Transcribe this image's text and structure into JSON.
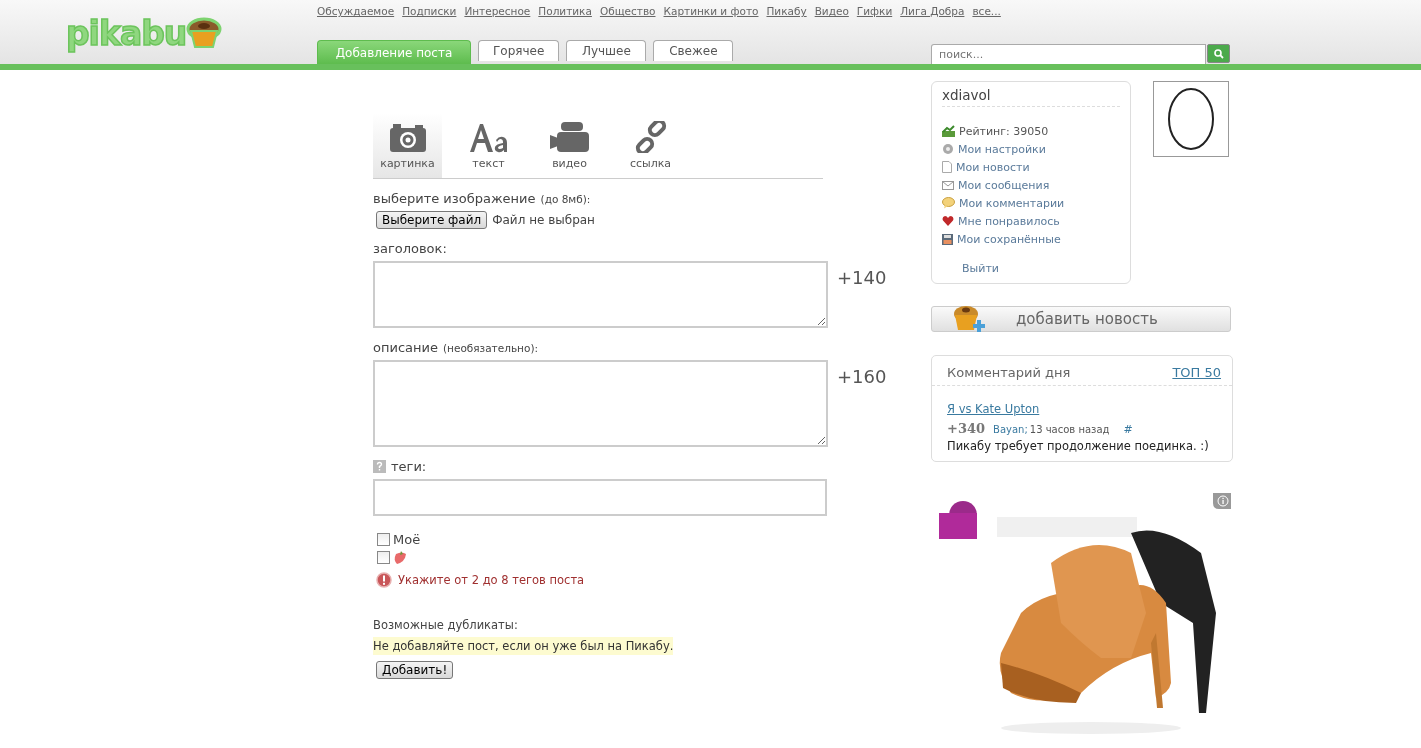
{
  "logo": {
    "text": "pikabu"
  },
  "top_links": [
    "Обсуждаемое",
    "Подписки",
    "Интересное",
    "Политика",
    "Общество",
    "Картинки и фото",
    "Пикабу",
    "Видео",
    "Гифки",
    "Лига Добра",
    "все..."
  ],
  "tabs": [
    {
      "label": "Добавление поста",
      "selected": true
    },
    {
      "label": "Горячее",
      "selected": false
    },
    {
      "label": "Лучшее",
      "selected": false
    },
    {
      "label": "Свежее",
      "selected": false
    }
  ],
  "search": {
    "placeholder": "поиск..."
  },
  "post_types": [
    {
      "label": "картинка",
      "selected": true
    },
    {
      "label": "текст",
      "selected": false
    },
    {
      "label": "видео",
      "selected": false
    },
    {
      "label": "ссылка",
      "selected": false
    }
  ],
  "form": {
    "image_label": "выберите изображение",
    "image_note": "(до 8мб):",
    "file_button": "Выберите файл",
    "file_status": "Файл не выбран",
    "title_label": "заголовок:",
    "title_counter": "+140",
    "desc_label": "описание",
    "desc_note": "(необязательно):",
    "desc_counter": "+160",
    "tags_label": "теги:",
    "checkboxes": [
      {
        "kind": "text",
        "label": "Моё",
        "checked": false
      },
      {
        "kind": "strawberry",
        "checked": false
      }
    ],
    "error": "Укажите от 2 до 8 тегов поста",
    "duplicates_label": "Возможные дубликаты:",
    "duplicates_note": "Не добавляйте пост, если он уже был на Пикабу.",
    "submit": "Добавить!"
  },
  "user_panel": {
    "username": "xdiavol",
    "rating": "Рейтинг: 39050",
    "menu": [
      "Мои настройки",
      "Мои новости",
      "Мои сообщения",
      "Мои комментарии",
      "Мне понравилось",
      "Мои сохранённые"
    ],
    "logout": "Выйти"
  },
  "add_news_button": "добавить новость",
  "comment_of_day": {
    "title": "Комментарий дня",
    "top_link": "ТОП 50",
    "post_link": "Я vs Kate Upton",
    "score": "+340",
    "author": "Bayan;",
    "time": "13 часов назад",
    "hash": "#",
    "text": "Пикабу требует продолжение поединка. :)"
  }
}
